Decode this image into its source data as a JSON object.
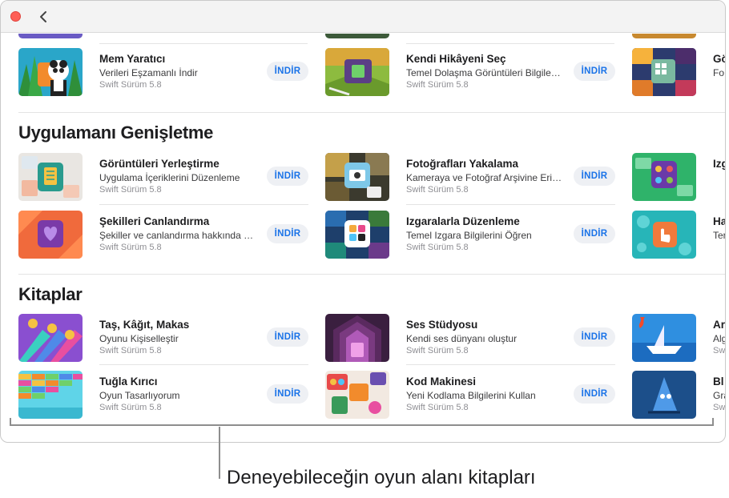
{
  "window": {
    "back_icon": "chevron-left-icon"
  },
  "sections": [
    {
      "title": ""
    },
    {
      "title": "Uygulamanı Genişletme"
    },
    {
      "title": "Kitaplar"
    }
  ],
  "top_row": [
    {
      "title": "Mem Yaratıcı",
      "subtitle": "Verileri Eşzamanlı İndir",
      "version": "Swift Sürüm 5.8",
      "button": "İNDİR"
    },
    {
      "title": "Kendi Hikâyeni Seç",
      "subtitle": "Temel Dolaşma Görüntüleri Bilgilerini Öğren",
      "version": "Swift Sürüm 5.8",
      "button": "İNDİR"
    },
    {
      "title": "Gö",
      "subtitle": "Fo",
      "version": ""
    }
  ],
  "expand": [
    {
      "title": "Görüntüleri Yerleştirme",
      "subtitle": "Uygulama İçeriklerini Düzenleme",
      "version": "Swift Sürüm 5.8",
      "button": "İNDİR"
    },
    {
      "title": "Fotoğrafları Yakalama",
      "subtitle": "Kameraya ve Fotoğraf Arşivine Erişim",
      "version": "Swift Sürüm 5.8",
      "button": "İNDİR"
    },
    {
      "title": "Izg",
      "subtitle": "",
      "version": ""
    },
    {
      "title": "Şekilleri Canlandırma",
      "subtitle": "Şekiller ve canlandırma hakkında bilgi edin",
      "version": "Swift Sürüm 5.8",
      "button": "İNDİR"
    },
    {
      "title": "Izgaralarla Düzenleme",
      "subtitle": "Temel Izgara Bilgilerini Öğren",
      "version": "Swift Sürüm 5.8",
      "button": "İNDİR"
    },
    {
      "title": "Ha",
      "subtitle": "Ter",
      "version": ""
    }
  ],
  "books": [
    {
      "title": "Taş, Kâğıt, Makas",
      "subtitle": "Oyunu Kişiselleştir",
      "version": "Swift Sürüm 5.8",
      "button": "İNDİR"
    },
    {
      "title": "Ses Stüdyosu",
      "subtitle": "Kendi ses dünyanı oluştur",
      "version": "Swift Sürüm 5.8",
      "button": "İNDİR"
    },
    {
      "title": "Ar",
      "subtitle": "Alg",
      "version": "Sw"
    },
    {
      "title": "Tuğla Kırıcı",
      "subtitle": "Oyun Tasarlıyorum",
      "version": "Swift Sürüm 5.8",
      "button": "İNDİR"
    },
    {
      "title": "Kod Makinesi",
      "subtitle": "Yeni Kodlama Bilgilerini Kullan",
      "version": "Swift Sürüm 5.8",
      "button": "İNDİR"
    },
    {
      "title": "Bl",
      "subtitle": "Gra",
      "version": "Sw"
    }
  ],
  "callout": {
    "text": "Deneyebileceğin oyun alanı kitapları"
  },
  "colors": {
    "accent": "#1a73e8",
    "button_bg": "#eef0f4",
    "close": "#fe5f57"
  }
}
